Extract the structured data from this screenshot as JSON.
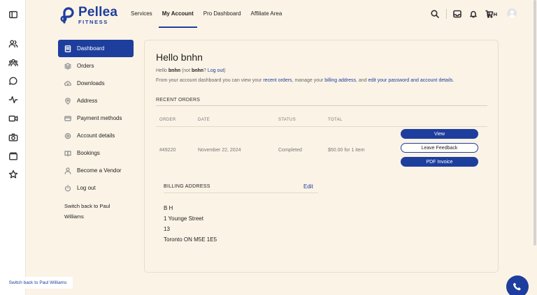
{
  "brand": {
    "name": "Pellea",
    "sub": "FITNESS",
    "color": "#1e3e9e"
  },
  "nav": [
    {
      "label": "Services",
      "active": false
    },
    {
      "label": "My Account",
      "active": true
    },
    {
      "label": "Pro Dashboard",
      "active": false
    },
    {
      "label": "Affiliate Area",
      "active": false
    }
  ],
  "header": {
    "initials": "B H",
    "icons": [
      "search-icon",
      "inbox-icon",
      "bell-icon",
      "cart-icon"
    ]
  },
  "rail_icons": [
    "sidebar-toggle-icon",
    "users-icon",
    "group-icon",
    "chat-icon",
    "activity-icon",
    "video-icon",
    "camera-icon",
    "folder-icon",
    "star-icon"
  ],
  "sidebar": {
    "items": [
      {
        "label": "Dashboard",
        "icon": "dashboard-icon",
        "active": true
      },
      {
        "label": "Orders",
        "icon": "orders-icon",
        "active": false
      },
      {
        "label": "Downloads",
        "icon": "download-icon",
        "active": false
      },
      {
        "label": "Address",
        "icon": "location-icon",
        "active": false
      },
      {
        "label": "Payment methods",
        "icon": "card-icon",
        "active": false
      },
      {
        "label": "Account details",
        "icon": "gear-icon",
        "active": false
      },
      {
        "label": "Bookings",
        "icon": "book-icon",
        "active": false
      },
      {
        "label": "Become a Vendor",
        "icon": "person-icon",
        "active": false
      },
      {
        "label": "Log out",
        "icon": "power-icon",
        "active": false
      }
    ],
    "switch_back": "Switch back to Paul Williams"
  },
  "main": {
    "greeting": "Hello bnhn",
    "hello_prefix": "Hello ",
    "hello_user": "bnhn",
    "hello_not": " (not ",
    "hello_user2": "bnhn",
    "hello_q": "? ",
    "logout": "Log out",
    "hello_close": ")",
    "intro_a": "From your account dashboard you can view your ",
    "intro_link1": "recent orders",
    "intro_b": ", manage your ",
    "intro_link2": "billing address",
    "intro_c": ", and ",
    "intro_link3": "edit your password and account details",
    "intro_d": ".",
    "recent_title": "RECENT ORDERS",
    "columns": [
      "ORDER",
      "DATE",
      "STATUS",
      "TOTAL"
    ],
    "order": {
      "id": "#49220",
      "date": "November 22, 2024",
      "status": "Completed",
      "total": "$50.00 for 1 item"
    },
    "buttons": {
      "view": "View",
      "feedback": "Leave Feedback",
      "invoice": "PDF Invoice"
    },
    "billing_title": "BILLING ADDRESS",
    "billing_edit": "Edit",
    "address": [
      "B H",
      "1 Younge Street",
      "13",
      "Toronto ON M5E 1E5"
    ]
  },
  "footer": {
    "switch_back": "Switch back to Paul Williams"
  }
}
